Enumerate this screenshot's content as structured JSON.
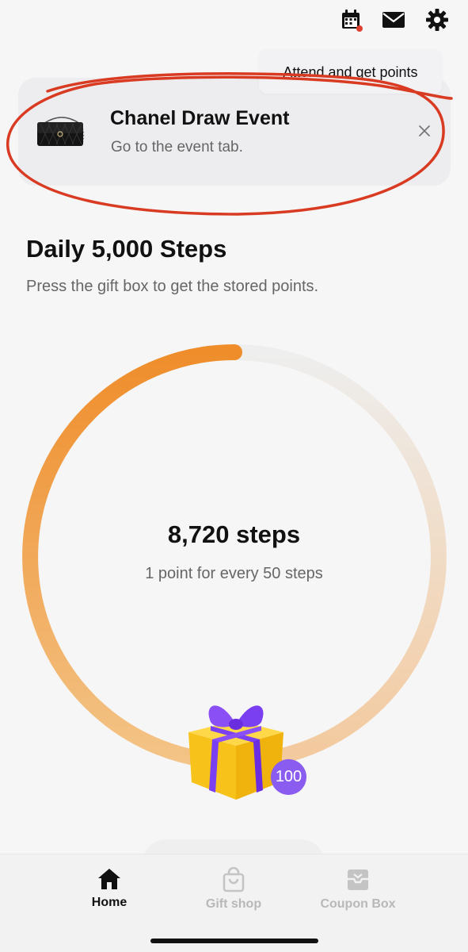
{
  "header": {
    "icons": [
      "calendar-icon",
      "mail-icon",
      "gear-icon"
    ],
    "tooltip": "Attend and get points"
  },
  "banner": {
    "title": "Chanel Draw Event",
    "subtitle": "Go to the event tab."
  },
  "main": {
    "title": "Daily 5,000 Steps",
    "subtitle": "Press the gift box to get the stored points.",
    "steps_text": "8,720 steps",
    "rate_text": "1 point for every 50 steps",
    "progress_fraction": 0.98,
    "gift_points": "100"
  },
  "tabs": [
    {
      "label": "Home",
      "icon": "home-icon",
      "active": true
    },
    {
      "label": "Gift shop",
      "icon": "shopping-bag-icon",
      "active": false
    },
    {
      "label": "Coupon Box",
      "icon": "inbox-icon",
      "active": false
    }
  ],
  "colors": {
    "accent_orange": "#f0912f",
    "badge_purple": "#8a5cf0",
    "annotation_red": "#d93a22"
  }
}
